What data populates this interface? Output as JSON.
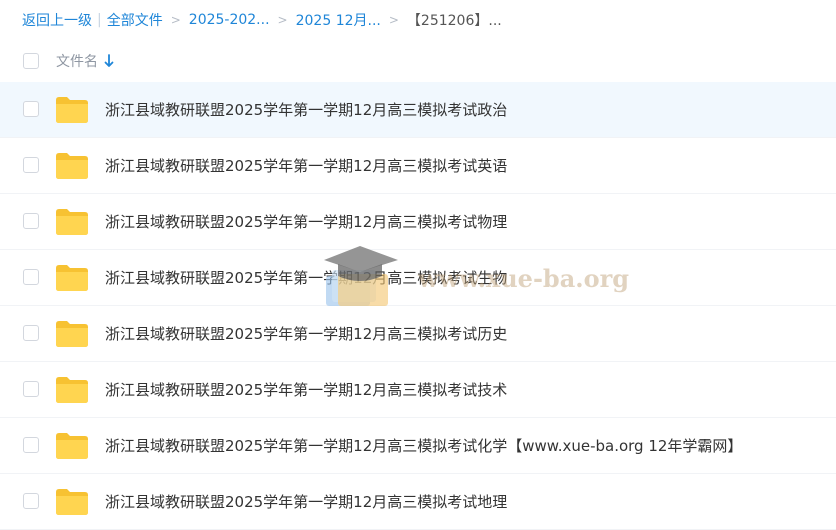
{
  "breadcrumb": {
    "back": "返回上一级",
    "all_files": "全部文件",
    "crumbs": [
      "2025-202...",
      "2025 12月..."
    ],
    "current": "【251206】..."
  },
  "header": {
    "name_label": "文件名",
    "sort_icon": "arrow-down-icon"
  },
  "rows": [
    {
      "name": "浙江县域教研联盟2025学年第一学期12月高三模拟考试政治",
      "icon": "folder-icon"
    },
    {
      "name": "浙江县域教研联盟2025学年第一学期12月高三模拟考试英语",
      "icon": "folder-icon"
    },
    {
      "name": "浙江县域教研联盟2025学年第一学期12月高三模拟考试物理",
      "icon": "folder-icon"
    },
    {
      "name": "浙江县域教研联盟2025学年第一学期12月高三模拟考试生物",
      "icon": "folder-icon"
    },
    {
      "name": "浙江县域教研联盟2025学年第一学期12月高三模拟考试历史",
      "icon": "folder-icon"
    },
    {
      "name": "浙江县域教研联盟2025学年第一学期12月高三模拟考试技术",
      "icon": "folder-icon"
    },
    {
      "name": "浙江县域教研联盟2025学年第一学期12月高三模拟考试化学【www.xue-ba.org 12年学霸网】",
      "icon": "folder-icon"
    },
    {
      "name": "浙江县域教研联盟2025学年第一学期12月高三模拟考试地理",
      "icon": "folder-icon"
    }
  ],
  "watermark": {
    "text": "www.xue-ba.org"
  },
  "colors": {
    "link": "#1f86d8",
    "folder": "#ffd24a",
    "selected_row": "#f1f8fe"
  }
}
